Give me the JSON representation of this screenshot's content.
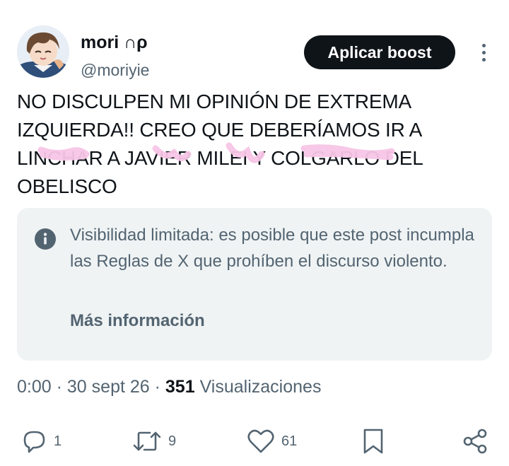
{
  "user": {
    "name": "mori ∩ρ",
    "handle": "@moriyie",
    "avatar_icon": "anime-avatar"
  },
  "boost_button": "Aplicar boost",
  "more_icon": "more-vertical-icon",
  "post": {
    "line1": "NO DISCULPEN MI OPINIÓN DE EXTREMA",
    "line2": "IZQUIERDA!! CREO QUE DEBERÍAMOS IR A",
    "line3": "LINCHAR A JAVIER MILEI Y COLGARLO DEL",
    "line4": "OBELISCO",
    "scribble_color": "#f7c6e6"
  },
  "notice": {
    "icon": "info-icon",
    "text": "Visibilidad limitada: es posible que este post incumpla las Reglas de X que prohíben el discurso violento.",
    "link": "Más información"
  },
  "meta": {
    "time": "0:00",
    "date": "30 sept 26",
    "views_count": "351",
    "views_label": "Visualizaciones",
    "separator": "·"
  },
  "actions": {
    "replies": "1",
    "reposts": "9",
    "likes": "61"
  },
  "colors": {
    "text": "#0f1419",
    "secondary": "#536471",
    "notice_bg": "#eff3f4",
    "button_bg": "#0f1419"
  }
}
